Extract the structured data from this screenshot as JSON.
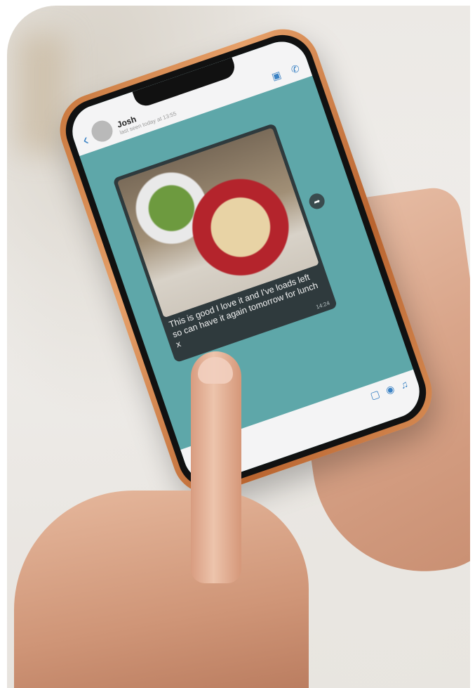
{
  "chat": {
    "contact_name": "Josh",
    "last_seen": "last seen today at 13:55",
    "back_icon": "chevron-left-icon",
    "video_icon": "video-camera-icon",
    "call_icon": "phone-icon"
  },
  "message": {
    "caption": "This is good I love it and I've loads left so can have it again tomorrow for lunch x",
    "time": "14:24",
    "forward_icon": "forward-arrow-icon"
  },
  "input": {
    "sticker_icon": "sticker-icon",
    "camera_icon": "camera-icon",
    "mic_icon": "microphone-icon"
  },
  "colors": {
    "chat_background": "#5ea7a9",
    "bubble": "#2f3a3d",
    "accent": "#3b82c4",
    "phone_frame": "#d68a52"
  }
}
